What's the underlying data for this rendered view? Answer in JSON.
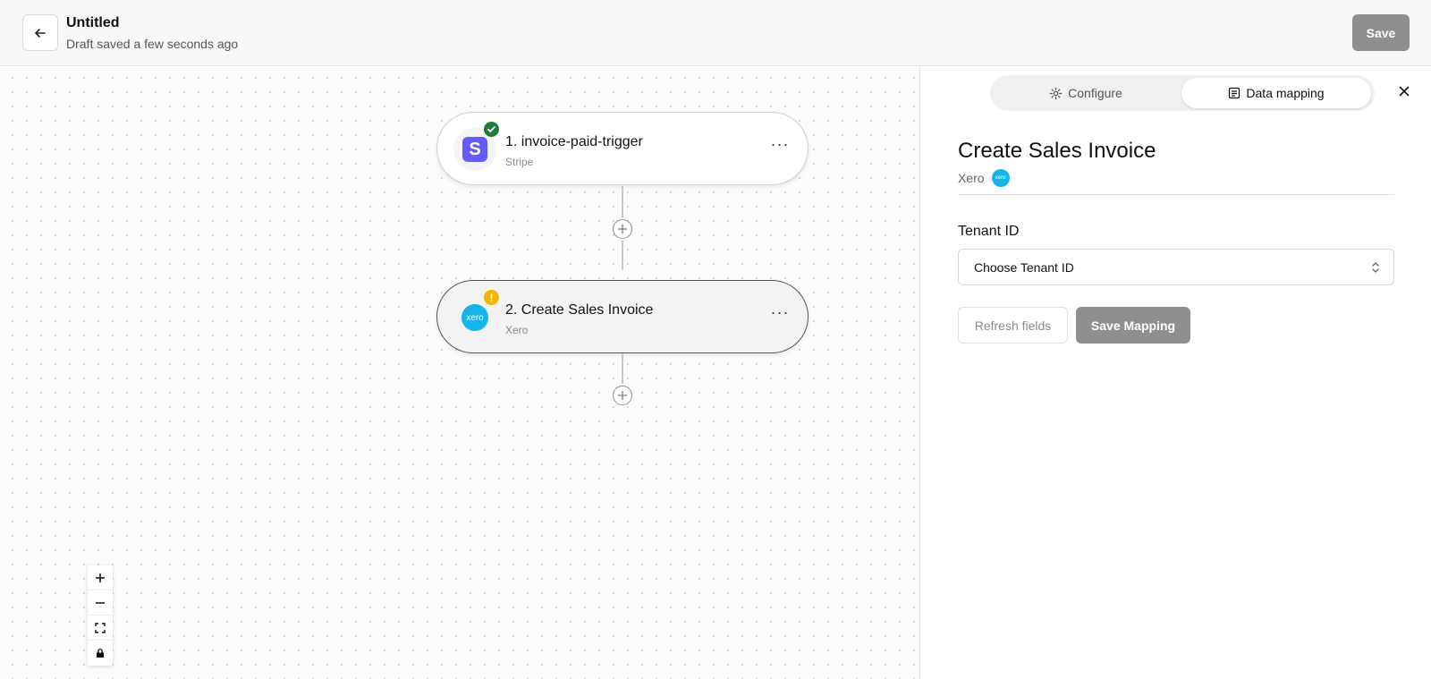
{
  "header": {
    "title": "Untitled",
    "subtitle": "Draft saved a few seconds ago",
    "save_label": "Save"
  },
  "nodes": [
    {
      "title": "1. invoice-paid-trigger",
      "app": "Stripe",
      "status": "success",
      "icon": "stripe-logo-icon"
    },
    {
      "title": "2. Create Sales Invoice",
      "app": "Xero",
      "status": "warning",
      "icon": "xero-logo-icon"
    }
  ],
  "icons": {
    "stripe_letter": "S",
    "xero_text": "xero",
    "more": "···",
    "warn": "!"
  },
  "colors": {
    "stripe": "#635bff",
    "xero": "#13b5ea",
    "success": "#1f7a3a",
    "warning": "#f2b600",
    "primary_disabled": "#8f8f8f"
  },
  "panel": {
    "tabs": [
      {
        "label": "Configure",
        "active": false
      },
      {
        "label": "Data mapping",
        "active": true
      }
    ],
    "title": "Create Sales Invoice",
    "app": "Xero",
    "field_label": "Tenant ID",
    "select_value": "Choose Tenant ID",
    "refresh_label": "Refresh fields",
    "save_mapping_label": "Save Mapping"
  }
}
